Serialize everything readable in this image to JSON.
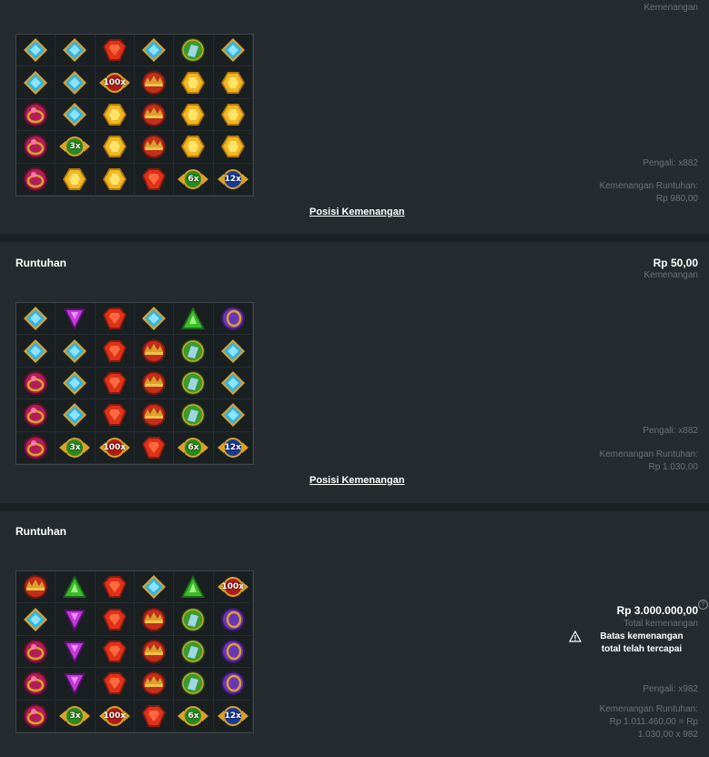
{
  "panels": [
    {
      "title": "",
      "top_label": "Kemenangan",
      "multiplier": "Pengali: x882",
      "cascade_label": "Kemenangan Runtuhan:",
      "cascade_value": "Rp 980,00",
      "link": "Posisi Kemenangan",
      "grid": [
        [
          "diamond-blue",
          "diamond-blue",
          "gem-red",
          "diamond-blue",
          "ring-green",
          "diamond-blue"
        ],
        [
          "diamond-blue",
          "diamond-blue",
          "mult-100x",
          "crown-red",
          "hexagon-gold",
          "hexagon-gold"
        ],
        [
          "ring-pink",
          "diamond-blue",
          "hexagon-gold",
          "crown-red",
          "hexagon-gold",
          "hexagon-gold"
        ],
        [
          "ring-pink",
          "mult-3x",
          "hexagon-gold",
          "crown-red",
          "hexagon-gold",
          "hexagon-gold"
        ],
        [
          "ring-pink",
          "hexagon-gold",
          "hexagon-gold",
          "gem-red",
          "mult-6x",
          "mult-12x"
        ]
      ]
    },
    {
      "title": "Runtuhan",
      "amount": "Rp 50,00",
      "top_label": "Kemenangan",
      "multiplier": "Pengali: x882",
      "cascade_label": "Kemenangan Runtuhan:",
      "cascade_value": "Rp 1.030,00",
      "link": "Posisi Kemenangan",
      "grid": [
        [
          "diamond-blue",
          "triangle-purple",
          "gem-red",
          "diamond-blue",
          "triangle-green",
          "ring-purple"
        ],
        [
          "diamond-blue",
          "diamond-blue",
          "gem-red",
          "crown-red",
          "ring-green",
          "diamond-blue"
        ],
        [
          "ring-pink",
          "diamond-blue",
          "gem-red",
          "crown-red",
          "ring-green",
          "diamond-blue"
        ],
        [
          "ring-pink",
          "diamond-blue",
          "gem-red",
          "crown-red",
          "ring-green",
          "diamond-blue"
        ],
        [
          "ring-pink",
          "mult-3x",
          "mult-100x",
          "gem-red",
          "mult-6x",
          "mult-12x"
        ]
      ]
    },
    {
      "title": "Runtuhan",
      "amount": "Rp 3.000.000,00",
      "top_label": "Total kemenangan",
      "warning_line1": "Batas kemenangan",
      "warning_line2": "total telah tercapai",
      "multiplier": "Pengali: x982",
      "cascade_label": "Kemenangan Runtuhan:",
      "cascade_value_line1": "Rp 1.011.460,00 = Rp",
      "cascade_value_line2": "1.030,00 x 982",
      "grid": [
        [
          "crown-red",
          "triangle-green",
          "gem-red",
          "diamond-blue",
          "triangle-green",
          "mult-100x"
        ],
        [
          "diamond-blue",
          "triangle-purple",
          "gem-red",
          "crown-red",
          "ring-green",
          "ring-purple"
        ],
        [
          "ring-pink",
          "triangle-purple",
          "gem-red",
          "crown-red",
          "ring-green",
          "ring-purple"
        ],
        [
          "ring-pink",
          "triangle-purple",
          "gem-red",
          "crown-red",
          "ring-green",
          "ring-purple"
        ],
        [
          "ring-pink",
          "mult-3x",
          "mult-100x",
          "gem-red",
          "mult-6x",
          "mult-12x"
        ]
      ]
    }
  ],
  "colors": {
    "page_bg": "#1b2023",
    "panel_bg": "#252b2e",
    "muted_text": "#6b7478"
  }
}
